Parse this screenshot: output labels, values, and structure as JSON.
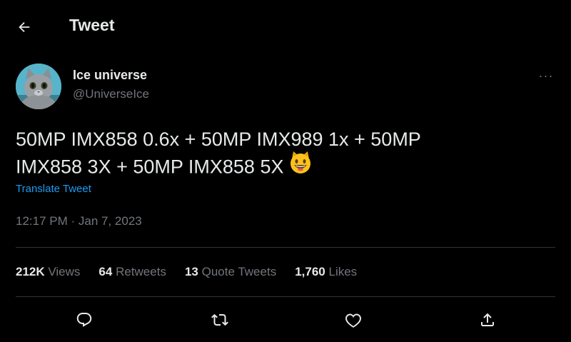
{
  "header": {
    "title": "Tweet",
    "back_icon": "arrow-left-icon"
  },
  "author": {
    "display_name": "Ice universe",
    "handle": "@UniverseIce",
    "avatar": "cat-avatar"
  },
  "more_icon": "more-horizontal-icon",
  "more_label": "···",
  "tweet": {
    "line1": "50MP IMX858 0.6x + 50MP IMX989 1x + 50MP",
    "line2": "IMX858 3X + 50MP IMX858 5X",
    "emoji": "grinning-cat-icon"
  },
  "translate_label": "Translate Tweet",
  "timestamp": "12:17 PM · Jan 7, 2023",
  "stats": {
    "views_count": "212K",
    "views_label": "Views",
    "retweets_count": "64",
    "retweets_label": "Retweets",
    "quotes_count": "13",
    "quotes_label": "Quote Tweets",
    "likes_count": "1,760",
    "likes_label": "Likes"
  },
  "actions": [
    "reply-icon",
    "retweet-icon",
    "like-icon",
    "share-icon"
  ],
  "colors": {
    "background": "#000000",
    "text": "#e7e9ea",
    "muted": "#71767b",
    "link": "#1d9bf0",
    "divider": "#2f3336"
  }
}
